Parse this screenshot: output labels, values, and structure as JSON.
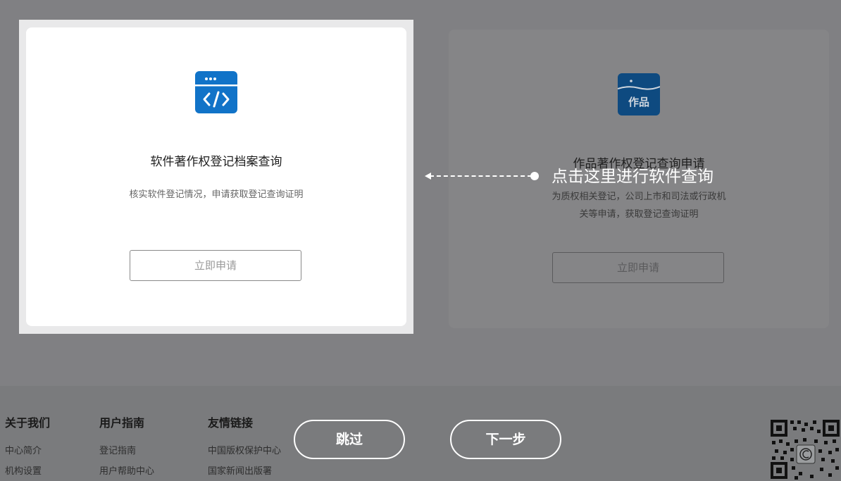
{
  "cards": [
    {
      "title": "软件著作权登记档案查询",
      "desc_lines": [
        "核实软件登记情况，申请获取登记查询证明"
      ],
      "button": "立即申请",
      "icon": "code-window-icon",
      "icon_color": "#1173c8"
    },
    {
      "title": "作品著作权登记查询申请",
      "desc_lines": [
        "为质权相关登记，公司上市和司法或行政机",
        "关等申请，获取登记查询证明"
      ],
      "button": "立即申请",
      "icon": "artwork-icon",
      "icon_glyph": "作品",
      "icon_color": "#0e4a80"
    }
  ],
  "hint": {
    "text": "点击这里进行软件查询"
  },
  "guide": {
    "skip": "跳过",
    "next": "下一步"
  },
  "footer": {
    "cols": [
      {
        "title": "关于我们",
        "links": [
          "中心简介",
          "机构设置"
        ]
      },
      {
        "title": "用户指南",
        "links": [
          "登记指南",
          "用户帮助中心"
        ]
      },
      {
        "title": "友情链接",
        "links": [
          "中国版权保护中心",
          "国家新闻出版署"
        ]
      }
    ]
  },
  "colors": {
    "overlay": "#808083",
    "highlight_frame": "#e9e9ea",
    "card_bg": "#ffffff"
  }
}
